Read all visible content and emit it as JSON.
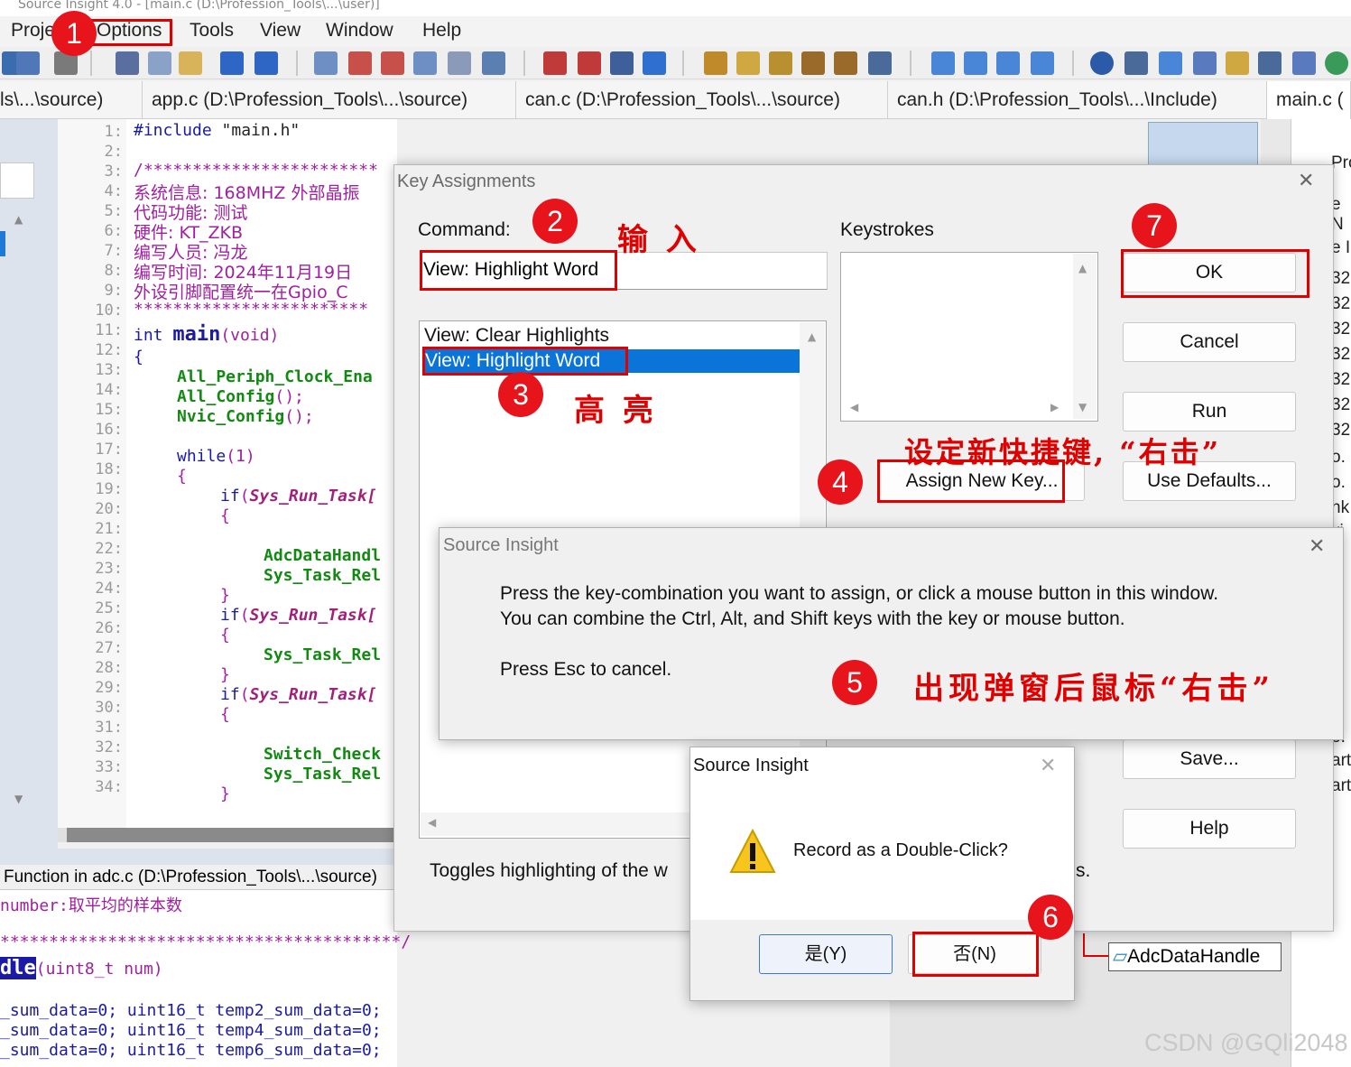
{
  "window": {
    "title_partial": "Source Insight 4.0 - [main.c (D:\\Profession_Tools\\...\\user)]"
  },
  "menu": {
    "items": [
      "Proje",
      "Options",
      "Tools",
      "View",
      "Window",
      "Help"
    ]
  },
  "tabs": [
    "ls\\...\\source)",
    "app.c (D:\\Profession_Tools\\...\\source)",
    "can.c (D:\\Profession_Tools\\...\\source)",
    "can.h (D:\\Profession_Tools\\...\\Include)",
    "main.c ("
  ],
  "editor": {
    "line_numbers": [
      "1:",
      "2:",
      "3:",
      "4:",
      "5:",
      "6:",
      "7:",
      "8:",
      "9:",
      "10:",
      "11:",
      "12:",
      "13:",
      "14:",
      "15:",
      "16:",
      "17:",
      "18:",
      "19:",
      "20:",
      "21:",
      "22:",
      "23:",
      "24:",
      "25:",
      "26:",
      "27:",
      "28:",
      "29:",
      "30:",
      "31:",
      "32:",
      "33:",
      "34:"
    ],
    "l1_kw": "#include",
    "l1_str": "\"main.h\"",
    "l3": "/************************",
    "l4": "系统信息: 168MHZ 外部晶振",
    "l5": "代码功能: 测试",
    "l6": "硬件: KT_ZKB",
    "l7": "编写人员: 冯龙",
    "l8": "编写时间: 2024年11月19日",
    "l9": "外设引脚配置统一在Gpio_C",
    "l10": "************************",
    "l11_kw": "int",
    "l11_fn": "main",
    "l11_rest": "(void)",
    "l12": "{",
    "l13": "All_Periph_Clock_Ena",
    "l14_fn": "All_Config",
    "l14_rest": "();",
    "l15_fn": "Nvic_Config",
    "l15_rest": "();",
    "l17_kw": "while",
    "l17_rest": "(1)",
    "l18": "{",
    "l19_kw": "if",
    "l19_rest": "Sys_Run_Task[",
    "l20": "{",
    "l22": "AdcDataHandl",
    "l23": "Sys_Task_Rel",
    "l24": "}",
    "l25_kw": "if",
    "l25_rest": "Sys_Run_Task[",
    "l26": "{",
    "l27": "Sys_Task_Rel",
    "l28": "}",
    "l29_kw": "if",
    "l29_rest": "Sys_Run_Task[",
    "l30": "{",
    "l32": "Switch_Check",
    "l33": "Sys_Task_Rel",
    "l34": "}"
  },
  "bottom_pane": {
    "header": "Function in adc.c (D:\\Profession_Tools\\...\\source)",
    "line1": "number:取平均的样本数",
    "line2": "*****************************************/",
    "line3_hl": "dle",
    "line3_rest": "(uint8_t num)",
    "line4": "_sum_data=0; uint16_t temp2_sum_data=0;",
    "line5": "_sum_data=0; uint16_t temp4_sum_data=0;",
    "line6": "_sum_data=0; uint16_t temp6_sum_data=0;"
  },
  "right_pane": {
    "items": [
      "Proje",
      "e N",
      "e I",
      "32",
      "32",
      "32",
      "32",
      "32",
      "32",
      "32",
      "o.",
      "o.",
      "nk",
      "ki",
      "n",
      "e",
      "e",
      "e",
      "ic",
      "e.",
      "art",
      "art"
    ]
  },
  "key_dialog": {
    "title": "Key Assignments",
    "command_label": "Command:",
    "command_value": "View: Highlight Word",
    "keystrokes_label": "Keystrokes",
    "list_items": [
      "View: Clear Highlights",
      "View: Highlight Word"
    ],
    "description": "Toggles highlighting of the w",
    "description_tail": "s.",
    "buttons": {
      "ok": "OK",
      "cancel": "Cancel",
      "run": "Run",
      "use_defaults": "Use Defaults...",
      "assign_new_key": "Assign New Key...",
      "save": "Save...",
      "help": "Help"
    }
  },
  "popup_press": {
    "title": "Source Insight",
    "line1": "Press the key-combination you want to assign, or click a mouse button in this window.",
    "line2": "You can combine the Ctrl, Alt, and Shift keys with the key or mouse button.",
    "line3": "Press Esc to cancel."
  },
  "popup_doubleclick": {
    "title": "Source Insight",
    "message": "Record as a Double-Click?",
    "yes": "是(Y)",
    "no": "否(N)"
  },
  "symbol_node": "AdcDataHandle",
  "annotations": {
    "badges": [
      "1",
      "2",
      "3",
      "4",
      "5",
      "6",
      "7"
    ],
    "note_input": "输 入",
    "note_highlight": "高 亮",
    "note_assign": "设定新快捷键, “右击”",
    "note_popup": "出现弹窗后鼠标“右击”"
  },
  "watermark": "CSDN @GQli2048",
  "colors": {
    "annotation_red": "#e00000",
    "badge_red": "#e8141b",
    "selection_blue": "#0a74d8",
    "keyword_blue": "#1a1aa6",
    "comment_purple": "#a020a0",
    "function_green": "#128a12"
  }
}
